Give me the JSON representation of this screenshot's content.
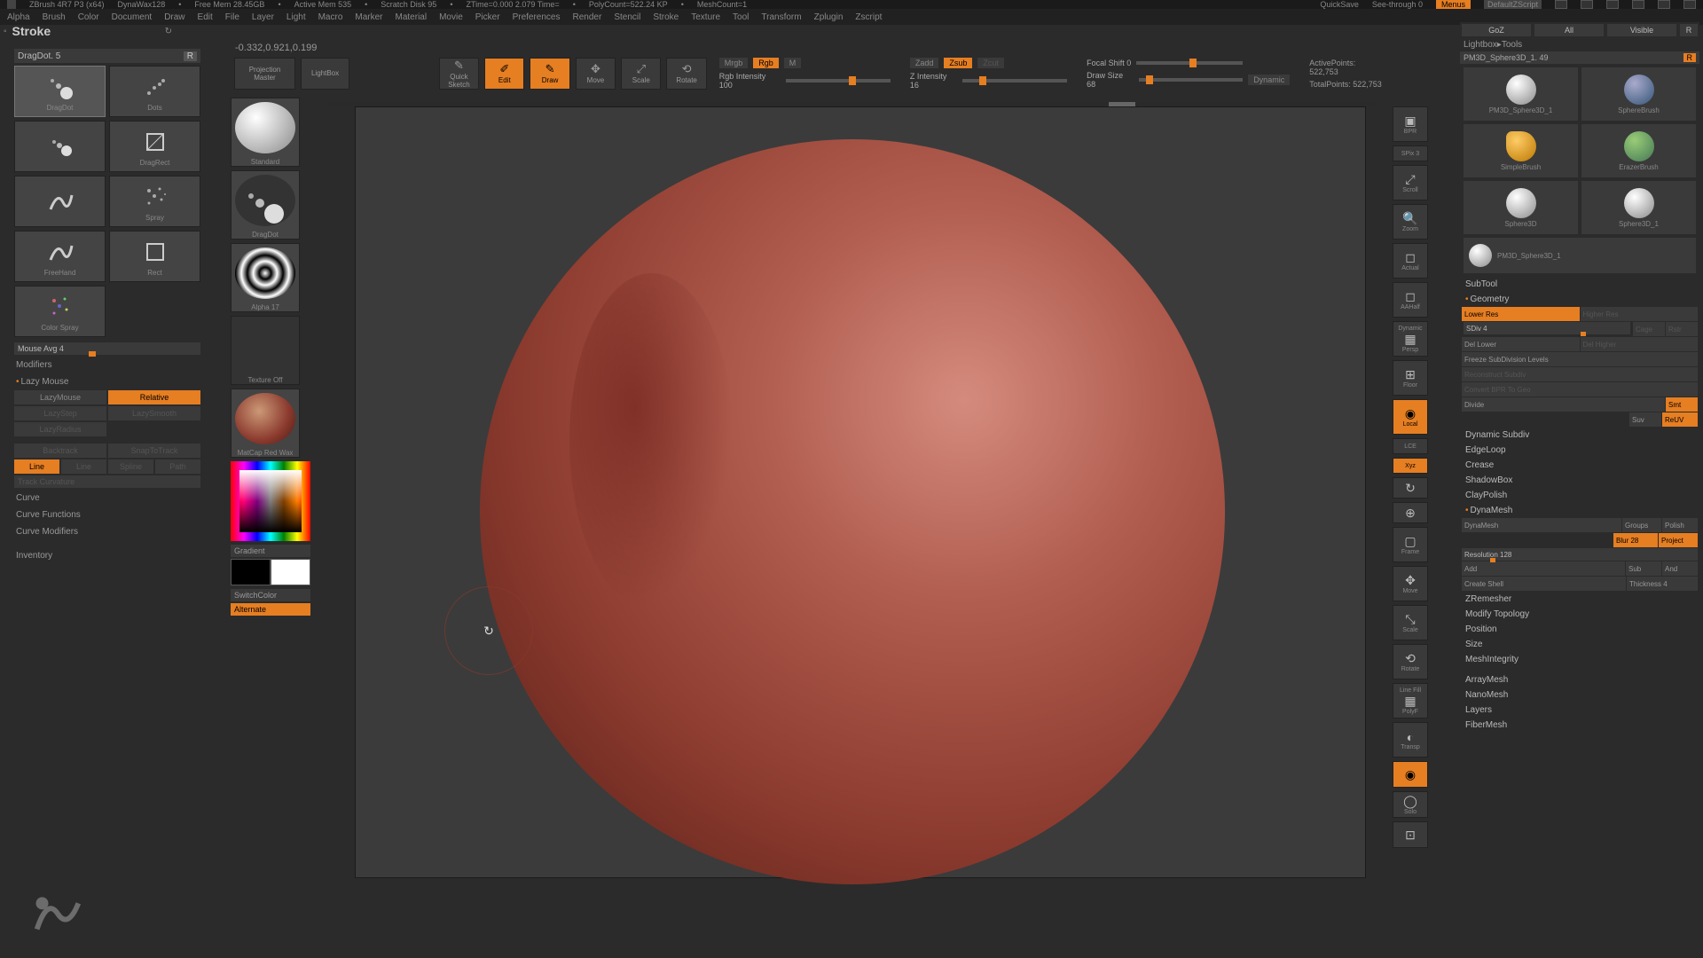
{
  "titlebar": {
    "app": "ZBrush 4R7 P3 (x64)",
    "material": "DynaWax128",
    "free_mem": "Free Mem  28.45GB",
    "active_mem": "Active Mem  535",
    "scratch": "Scratch Disk  95",
    "ztime": "ZTime=0.000  2.079 Time=",
    "polycount": "PolyCount=522.24 KP",
    "meshcount": "MeshCount=1",
    "quicksave": "QuickSave",
    "seethrough": "See-through  0",
    "menus": "Menus",
    "defaultz": "DefaultZScript"
  },
  "menu": [
    "Alpha",
    "Brush",
    "Color",
    "Document",
    "Draw",
    "Edit",
    "File",
    "Layer",
    "Light",
    "Macro",
    "Marker",
    "Material",
    "Movie",
    "Picker",
    "Preferences",
    "Render",
    "Stencil",
    "Stroke",
    "Texture",
    "Tool",
    "Transform",
    "Zplugin",
    "Zscript"
  ],
  "header": {
    "title": "Stroke"
  },
  "coords": "-0.332,0.921,0.199",
  "stroke": {
    "title": "DragDot. 5",
    "r": "R",
    "items": [
      {
        "name": "DragDot",
        "icon": "dragdot"
      },
      {
        "name": "Dots",
        "icon": "dots"
      },
      {
        "name": "",
        "icon": "ddrect"
      },
      {
        "name": "DragRect",
        "icon": "dragrect"
      },
      {
        "name": "",
        "icon": "fhand"
      },
      {
        "name": "Spray",
        "icon": "spray"
      },
      {
        "name": "FreeHand",
        "icon": "freehand"
      },
      {
        "name": "Rect",
        "icon": "rect"
      },
      {
        "name": "Color Spray",
        "icon": "cspray"
      },
      {
        "name": "",
        "icon": ""
      }
    ],
    "mouse_avg": "Mouse Avg 4",
    "modifiers": "Modifiers",
    "lazy_mouse": "Lazy Mouse",
    "lazy_row1a": "LazyMouse",
    "lazy_row1b": "Relative",
    "lazy_row2a": "LazyStep",
    "lazy_row2b": "LazySmooth",
    "lazy_row3": "LazyRadius",
    "backtrack": "Backtrack",
    "snap": "SnapToTrack",
    "track_modes": [
      "Line",
      "Line",
      "Spline",
      "Path"
    ],
    "track_curv": "Track Curvature",
    "curve": "Curve",
    "curve_fn": "Curve Functions",
    "curve_mod": "Curve Modifiers",
    "inventory": "Inventory"
  },
  "toolcol": {
    "standard": "Standard",
    "dragdot": "DragDot",
    "alpha": "Alpha 17",
    "texture_off": "Texture Off",
    "matcap": "MatCap Red Wax",
    "gradient": "Gradient",
    "switch": "SwitchColor",
    "alternate": "Alternate"
  },
  "toolbar": {
    "proj_master_a": "Projection",
    "proj_master_b": "Master",
    "lightbox": "LightBox",
    "quick": "Quick",
    "sketch": "Sketch",
    "edit": "Edit",
    "draw": "Draw",
    "move": "Move",
    "scale": "Scale",
    "rotate": "Rotate",
    "mrgb": "Mrgb",
    "rgb": "Rgb",
    "m": "M",
    "rgb_int": "Rgb Intensity 100",
    "zadd": "Zadd",
    "zsub": "Zsub",
    "zcut": "Zcut",
    "zint": "Z Intensity 16",
    "focal": "Focal Shift 0",
    "draw_size": "Draw Size 68",
    "dynamic": "Dynamic",
    "active_pts": "ActivePoints: 522,753",
    "total_pts": "TotalPoints: 522,753"
  },
  "right_icons": [
    {
      "lbl": "BPR",
      "g": "▣"
    },
    {
      "lbl": "SPix 3",
      "g": ""
    },
    {
      "lbl": "Scroll",
      "g": "⤢"
    },
    {
      "lbl": "Zoom",
      "g": "🔍"
    },
    {
      "lbl": "Actual",
      "g": "◻"
    },
    {
      "lbl": "AAHalf",
      "g": "◻"
    },
    {
      "lbl": "Persp",
      "g": "▦",
      "active": false,
      "sub": "Dynamic"
    },
    {
      "lbl": "Floor",
      "g": "⊞"
    },
    {
      "lbl": "Local",
      "g": "◉",
      "active": true
    },
    {
      "lbl": "LCE",
      "g": "L"
    },
    {
      "lbl": "Xyz",
      "g": "xyz",
      "active": true
    },
    {
      "lbl": "",
      "g": "↻"
    },
    {
      "lbl": "",
      "g": "⊕"
    },
    {
      "lbl": "Frame",
      "g": "▢"
    },
    {
      "lbl": "Move",
      "g": "✥"
    },
    {
      "lbl": "Scale",
      "g": "⤡"
    },
    {
      "lbl": "Rotate",
      "g": "⟲"
    },
    {
      "lbl": "PolyF",
      "g": "▦",
      "sub": "Line Fill"
    },
    {
      "lbl": "Transp",
      "g": "◐"
    },
    {
      "lbl": "",
      "g": "◉",
      "active": true
    },
    {
      "lbl": "Solo",
      "g": "◯"
    },
    {
      "lbl": "",
      "g": "⊡"
    }
  ],
  "rp": {
    "header": [
      "GoZ",
      "All",
      "Visible",
      "R"
    ],
    "breadcrumb": "Lightbox▸Tools",
    "tool_name": "PM3D_Sphere3D_1. 49",
    "r": "R",
    "tools": [
      {
        "name": "PM3D_Sphere3D_1",
        "ball": "#ccc"
      },
      {
        "name": "SphereBrush",
        "ball": "#6a7aa8"
      },
      {
        "name": "SimpleBrush",
        "ball": "#e6a23c"
      },
      {
        "name": "ErazerBrush",
        "ball": "#9a6"
      },
      {
        "name": "Sphere3D",
        "ball": "#ccc"
      },
      {
        "name": "Sphere3D_1",
        "ball": "#ccc"
      },
      {
        "name": "PM3D_Sphere3D_1",
        "ball": "#ccc"
      },
      {
        "name": "",
        "ball": ""
      }
    ],
    "subtool": "SubTool",
    "geometry": "Geometry",
    "lower_res": "Lower Res",
    "higher_res": "Higher Res",
    "sdiv": "SDiv 4",
    "cage": "Cage",
    "rstr": "Rstr",
    "del_lower": "Del Lower",
    "del_higher": "Del Higher",
    "freeze": "Freeze SubDivision Levels",
    "reconstruct": "Reconstruct Subdiv",
    "convert": "Convert BPR To Geo",
    "divide": "Divide",
    "smt": "Smt",
    "suv": "Suv",
    "reuv": "ReUV",
    "dyn_subdiv": "Dynamic Subdiv",
    "edgeloop": "EdgeLoop",
    "crease": "Crease",
    "shadowbox": "ShadowBox",
    "claypolish": "ClayPolish",
    "dynamesh": "DynaMesh",
    "dynamesh_btn": "DynaMesh",
    "groups": "Groups",
    "polish": "Polish",
    "blur": "Blur 28",
    "project": "Project",
    "resolution": "Resolution 128",
    "add": "Add",
    "sub": "Sub",
    "and": "And",
    "create_shell": "Create Shell",
    "thickness": "Thickness 4",
    "zremesher": "ZRemesher",
    "modify_topo": "Modify Topology",
    "position": "Position",
    "size": "Size",
    "meshint": "MeshIntegrity",
    "arraymesh": "ArrayMesh",
    "nanomesh": "NanoMesh",
    "layers": "Layers",
    "fibermesh": "FiberMesh"
  }
}
